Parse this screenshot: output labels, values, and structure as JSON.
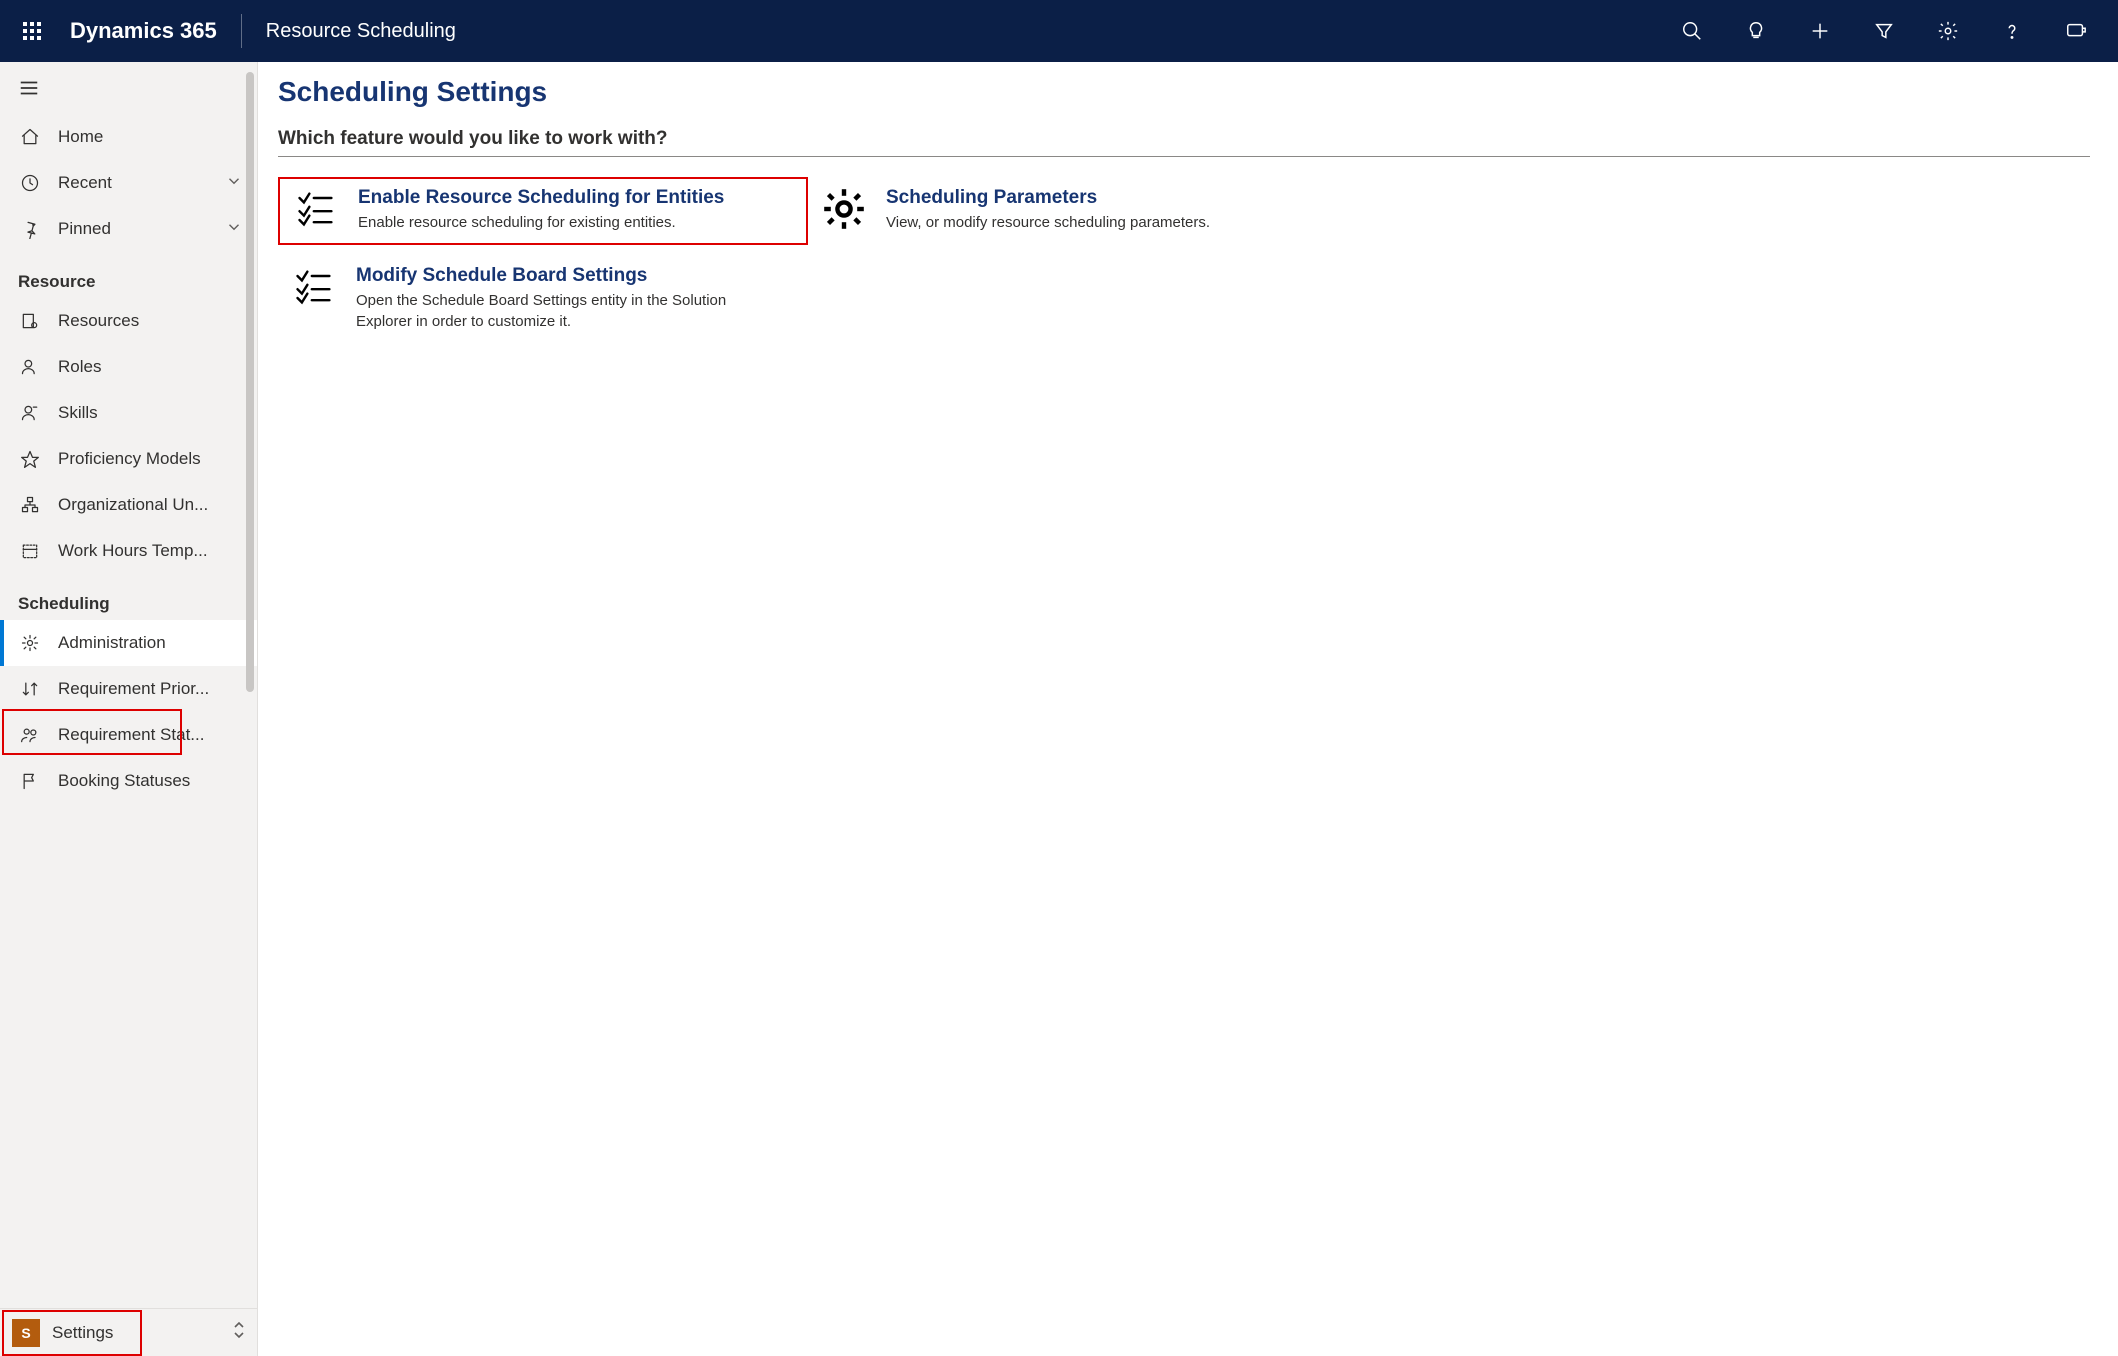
{
  "topbar": {
    "brand": "Dynamics 365",
    "app_area": "Resource Scheduling"
  },
  "sidebar": {
    "top_items": [
      {
        "label": "Home"
      },
      {
        "label": "Recent",
        "has_chevron": true
      },
      {
        "label": "Pinned",
        "has_chevron": true
      }
    ],
    "groups": [
      {
        "title": "Resource",
        "items": [
          {
            "label": "Resources"
          },
          {
            "label": "Roles"
          },
          {
            "label": "Skills"
          },
          {
            "label": "Proficiency Models"
          },
          {
            "label": "Organizational Un..."
          },
          {
            "label": "Work Hours Temp..."
          }
        ]
      },
      {
        "title": "Scheduling",
        "items": [
          {
            "label": "Administration",
            "active": true
          },
          {
            "label": "Requirement Prior..."
          },
          {
            "label": "Requirement Stat..."
          },
          {
            "label": "Booking Statuses"
          }
        ]
      }
    ],
    "area_switcher": {
      "badge": "S",
      "label": "Settings"
    }
  },
  "page": {
    "title": "Scheduling Settings",
    "prompt": "Which feature would you like to work with?",
    "tiles_left": [
      {
        "title": "Enable Resource Scheduling for Entities",
        "desc": "Enable resource scheduling for existing entities.",
        "highlight": true
      },
      {
        "title": "Modify Schedule Board Settings",
        "desc": "Open the Schedule Board Settings entity in the Solution Explorer in order to customize it."
      }
    ],
    "tiles_right": [
      {
        "title": "Scheduling Parameters",
        "desc": "View, or modify resource scheduling parameters."
      }
    ]
  }
}
